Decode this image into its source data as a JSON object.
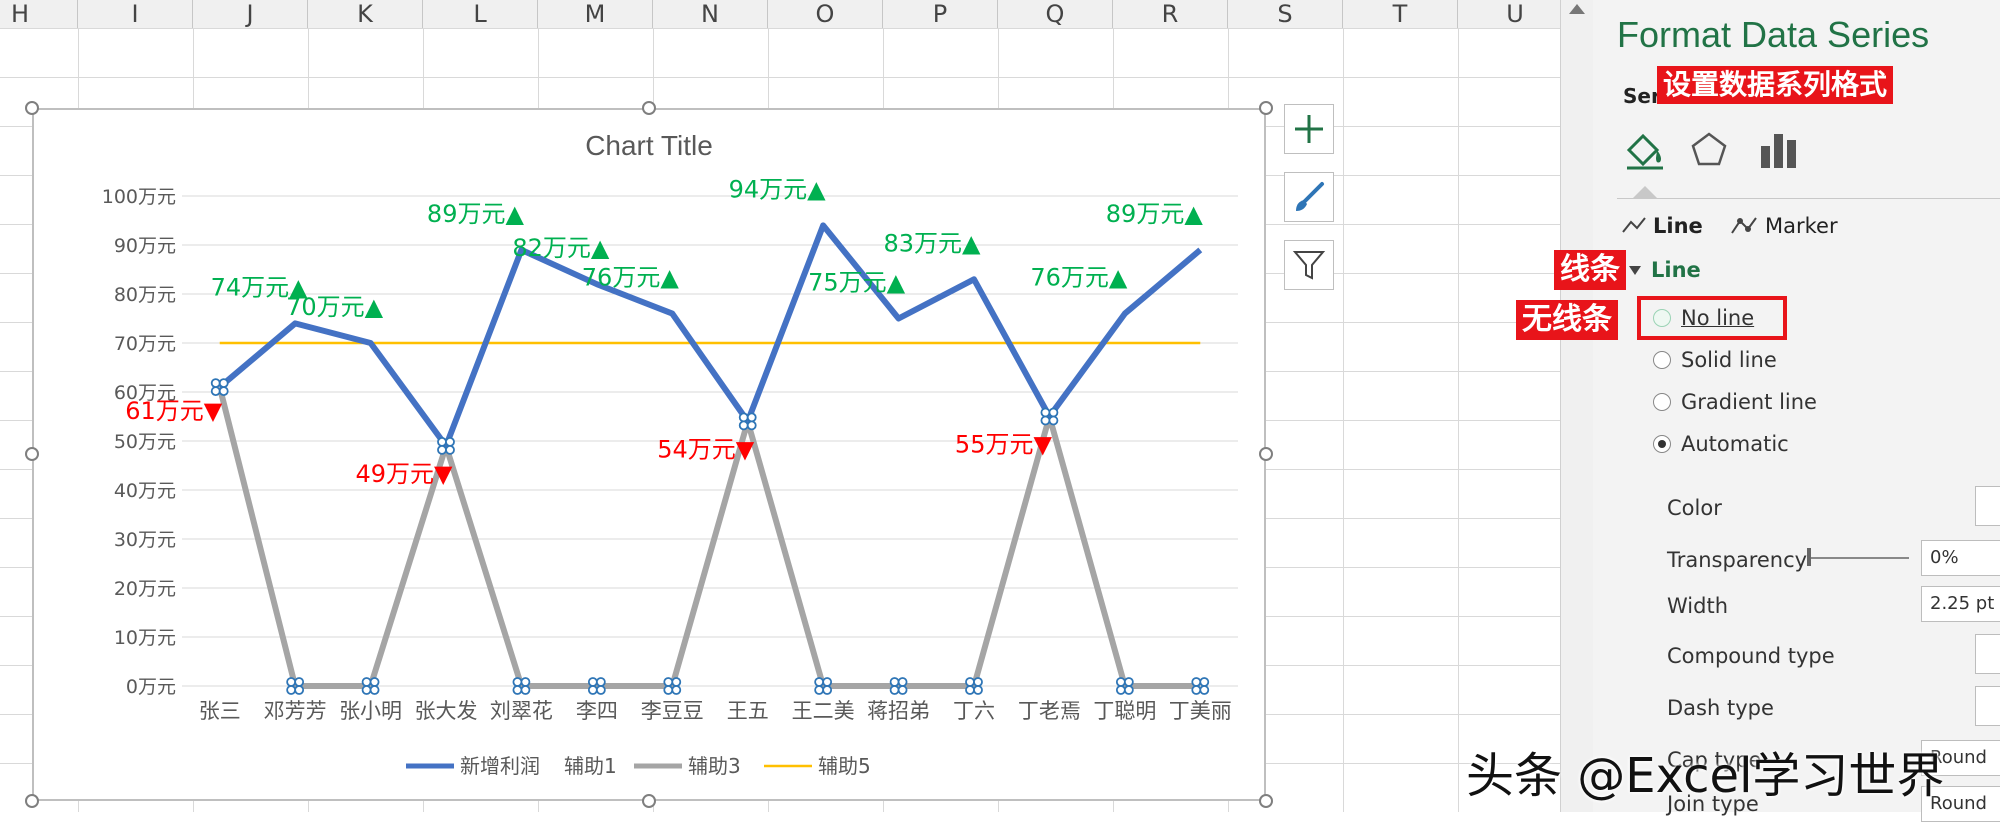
{
  "spreadsheet": {
    "columns": [
      "H",
      "I",
      "J",
      "K",
      "L",
      "M",
      "N",
      "O",
      "P",
      "Q",
      "R",
      "S",
      "T",
      "U"
    ]
  },
  "chart_data": {
    "type": "line",
    "title": "Chart Title",
    "categories": [
      "张三",
      "邓芳芳",
      "张小明",
      "张大发",
      "刘翠花",
      "李四",
      "李豆豆",
      "王五",
      "王二美",
      "蒋招弟",
      "丁六",
      "丁老焉",
      "丁聪明",
      "丁美丽"
    ],
    "ylim": [
      0,
      100
    ],
    "yticks": [
      "0万元",
      "10万元",
      "20万元",
      "30万元",
      "40万元",
      "50万元",
      "60万元",
      "70万元",
      "80万元",
      "90万元",
      "100万元"
    ],
    "grid": true,
    "legend_position": "bottom",
    "legend": [
      "新增利润",
      "辅助1",
      "辅助3",
      "辅助5"
    ],
    "series": [
      {
        "name": "新增利润",
        "color": "#4472c4",
        "values": [
          61,
          74,
          70,
          49,
          89,
          82,
          76,
          54,
          94,
          75,
          83,
          55,
          76,
          89
        ]
      },
      {
        "name": "辅助3",
        "color": "#a5a5a5",
        "values": [
          61,
          0,
          0,
          49,
          0,
          0,
          0,
          54,
          0,
          0,
          0,
          55,
          0,
          0
        ]
      },
      {
        "name": "辅助5",
        "color": "#ffc000",
        "values": [
          70,
          70,
          70,
          70,
          70,
          70,
          70,
          70,
          70,
          70,
          70,
          70,
          70,
          70
        ]
      }
    ],
    "data_labels": [
      {
        "text": "61万元▼",
        "color": "#ff0000"
      },
      {
        "text": "74万元▲",
        "color": "#00b050"
      },
      {
        "text": "70万元▲",
        "color": "#00b050"
      },
      {
        "text": "49万元▼",
        "color": "#ff0000"
      },
      {
        "text": "89万元▲",
        "color": "#00b050"
      },
      {
        "text": "82万元▲",
        "color": "#00b050"
      },
      {
        "text": "76万元▲",
        "color": "#00b050"
      },
      {
        "text": "54万元▼",
        "color": "#ff0000"
      },
      {
        "text": "94万元▲",
        "color": "#00b050"
      },
      {
        "text": "75万元▲",
        "color": "#00b050"
      },
      {
        "text": "83万元▲",
        "color": "#00b050"
      },
      {
        "text": "55万元▼",
        "color": "#ff0000"
      },
      {
        "text": "76万元▲",
        "color": "#00b050"
      },
      {
        "text": "89万元▲",
        "color": "#00b050"
      }
    ]
  },
  "chart_buttons": {
    "add_icon": "plus-icon",
    "style_icon": "brush-icon",
    "filter_icon": "filter-icon"
  },
  "panel": {
    "title": "Format Data Series",
    "subtitle": "Ser",
    "annotation_title": "设置数据系列格式",
    "tabs": [
      "fill-line-icon",
      "effects-icon",
      "series-options-icon"
    ],
    "subtabs": {
      "line": "Line",
      "marker": "Marker"
    },
    "section": "Line",
    "annotation_section": "线条",
    "annotation_noline": "无线条",
    "radios": [
      {
        "label": "No line",
        "selected": false
      },
      {
        "label": "Solid line",
        "selected": false
      },
      {
        "label": "Gradient line",
        "selected": false
      },
      {
        "label": "Automatic",
        "selected": true
      }
    ],
    "props": {
      "color": "Color",
      "transparency": "Transparency",
      "transparency_value": "0%",
      "width": "Width",
      "width_value": "2.25 pt",
      "compound": "Compound type",
      "dash": "Dash type",
      "cap": "Cap type",
      "cap_value": "Round",
      "join": "Join type",
      "join_value": "Round"
    },
    "accent_color": "#217346"
  },
  "watermark": "头条 @Excel学习世界"
}
